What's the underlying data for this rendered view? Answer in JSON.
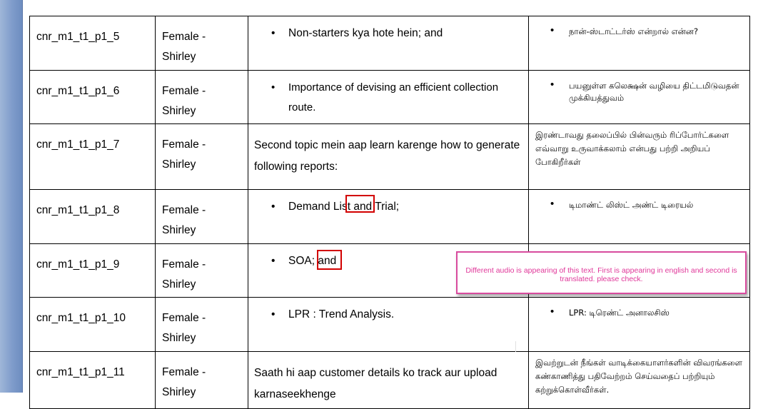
{
  "rows": [
    {
      "id": "cnr_m1_t1_p1_5",
      "speaker": [
        "Female -",
        "Shirley"
      ],
      "english": "Non-starters kya hote hein; and",
      "tamil": "நான்-ஸ்டாட்டர்ஸ் என்றால் என்ன?"
    },
    {
      "id": "cnr_m1_t1_p1_6",
      "speaker": [
        "Female -",
        "Shirley"
      ],
      "english": "Importance of devising an efficient collection route.",
      "tamil": "பயனுள்ள கலெக்ஷன் வழியை திட்டமிடுவதன் முக்கியத்துவம்"
    },
    {
      "id": "cnr_m1_t1_p1_7",
      "speaker": [
        "Female -",
        "Shirley"
      ],
      "english": "Second topic mein aap learn karenge how to generate following reports:",
      "tamil": "இரண்டாவது தலைப்பில் பின்வரும் ரிப்போர்ட்களை எவ்வாறு உருவாக்கலாம் என்பது பற்றி அறியப் போகிறீர்கள்"
    },
    {
      "id": "cnr_m1_t1_p1_8",
      "speaker": [
        "Female -",
        "Shirley"
      ],
      "english": "Demand List and Trial;",
      "tamil": "டிமாண்ட் லிஸ்ட் அண்ட் டிரையல்"
    },
    {
      "id": "cnr_m1_t1_p1_9",
      "speaker": [
        "Female -",
        "Shirley"
      ],
      "english": "SOA; and",
      "tamil": ""
    },
    {
      "id": "cnr_m1_t1_p1_10",
      "speaker": [
        "Female -",
        "Shirley"
      ],
      "english": "LPR : Trend Analysis.",
      "tamil": "LPR: டிரெண்ட் அனாலசிஸ்"
    },
    {
      "id": "cnr_m1_t1_p1_11",
      "speaker": [
        "Female -",
        "Shirley"
      ],
      "english": "Saath hi aap customer details ko track aur upload karnaseekhenge",
      "tamil": "இவற்றுடன் நீங்கள் வாடிக்கையாளர்களின் விவரங்களை கண்காணித்து பதிவேற்றம் செய்வதைப் பற்றியும் கற்றுக்கொள்வீர்கள்."
    }
  ],
  "bullet_glyph": "•",
  "comment": "Different audio is appearing of this text. First is appearing in english and second is translated. please check.",
  "colors": {
    "comment_border": "#d84b9e",
    "comment_text": "#e0389a",
    "highlight_box": "#d20000",
    "doc_edge": "#7f9ccb"
  }
}
